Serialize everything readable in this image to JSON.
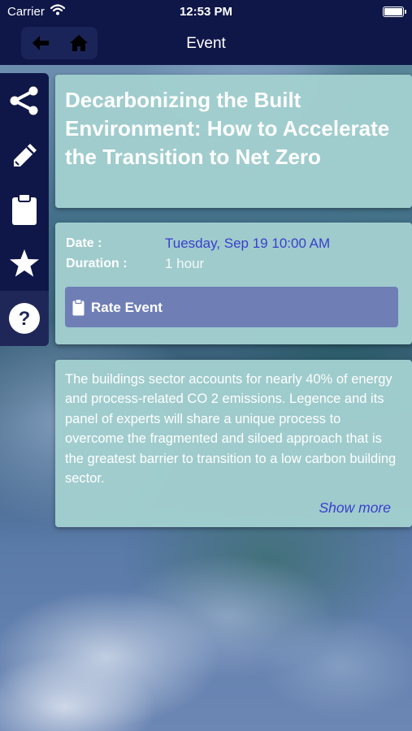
{
  "status_bar": {
    "carrier": "Carrier",
    "time": "12:53 PM"
  },
  "nav": {
    "title": "Event",
    "back_icon": "arrow-left-icon",
    "home_icon": "home-icon"
  },
  "side_menu": {
    "items": [
      {
        "icon": "share-icon"
      },
      {
        "icon": "pencil-icon"
      },
      {
        "icon": "clipboard-icon"
      },
      {
        "icon": "star-icon"
      },
      {
        "icon": "help-icon"
      }
    ]
  },
  "event": {
    "title": "Decarbonizing the Built Environment: How to Accelerate the Transition to Net Zero",
    "date_label": "Date :",
    "date_value": "Tuesday, Sep 19 10:00 AM",
    "duration_label": "Duration :",
    "duration_value": "1 hour",
    "rate_label": "Rate Event",
    "description": "The buildings sector accounts for nearly 40% of energy and process-related CO 2 emissions. Legence and its panel of experts will share a unique process to overcome the fragmented and siloed approach that is the greatest barrier to transition to a low carbon building sector.",
    "show_more": "Show more"
  },
  "colors": {
    "navy": "#0f1748",
    "card": "#a2cece",
    "link_blue": "#3a3fcc",
    "rate_button": "#6f7fb6"
  }
}
